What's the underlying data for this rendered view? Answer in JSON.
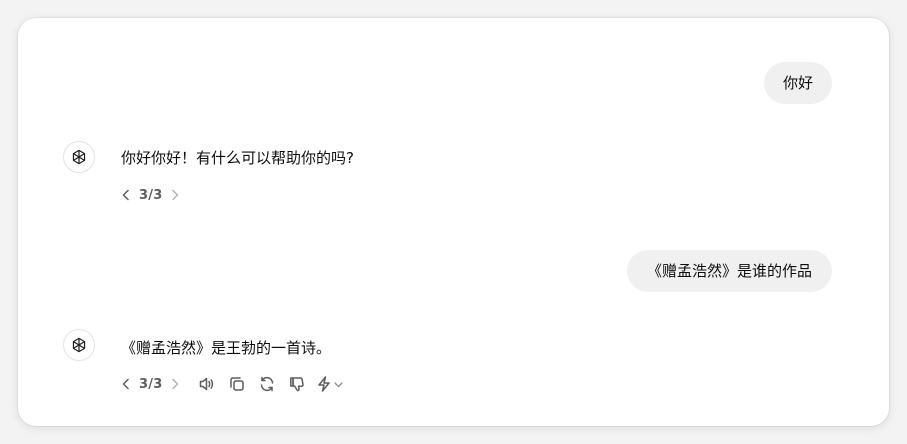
{
  "conversation": {
    "messages": [
      {
        "role": "user",
        "text": "你好"
      },
      {
        "role": "assistant",
        "text": "你好你好！有什么可以帮助你的吗?",
        "pager": "3/3"
      },
      {
        "role": "user",
        "text": "《赠孟浩然》是谁的作品"
      },
      {
        "role": "assistant",
        "text": "《赠孟浩然》是王勃的一首诗。",
        "pager": "3/3"
      }
    ]
  },
  "icons": {
    "avatar": "chatgpt-logo-icon",
    "prev": "chevron-left-icon",
    "next": "chevron-right-icon",
    "read_aloud": "speaker-icon",
    "copy": "copy-icon",
    "regenerate": "regenerate-icon",
    "dislike": "thumbs-down-icon",
    "model_switch": "lightning-icon",
    "model_dropdown": "chevron-down-icon"
  },
  "colors": {
    "bubble_bg": "#f0f0f0",
    "icon_gray": "#5d5d5d",
    "text": "#0d0d0d"
  }
}
